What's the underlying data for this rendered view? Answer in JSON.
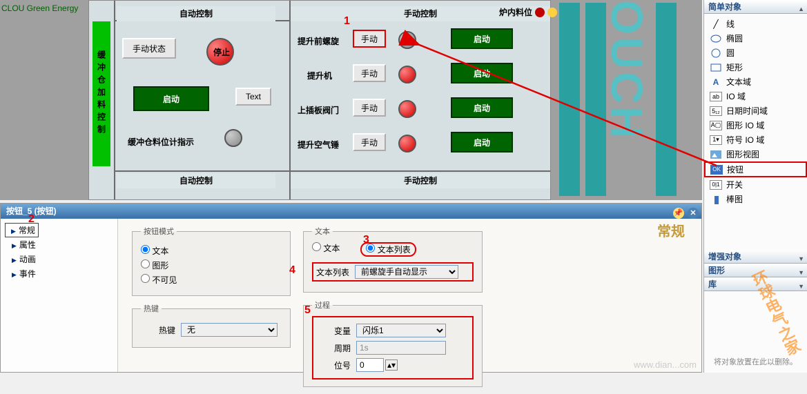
{
  "logo": {
    "brand": "CLOU Green Energy"
  },
  "hmi": {
    "side_label": "缓冲仓加料控制",
    "head_auto": "自动控制",
    "head_manual": "手动控制",
    "head_auto2": "自动控制",
    "head_manual2": "手动控制",
    "manual_status_btn": "手动状态",
    "stop_btn": "停止",
    "start_btn": "启动",
    "text_btn": "Text",
    "level_label": "缓冲仓料位计指示",
    "rows": [
      {
        "label": "提升前螺旋",
        "btn": "手动",
        "start": "启动"
      },
      {
        "label": "提升机",
        "btn": "手动",
        "start": "启动"
      },
      {
        "label": "上插板阀门",
        "btn": "手动",
        "start": "启动"
      },
      {
        "label": "提升空气锤",
        "btn": "手动",
        "start": "启动"
      }
    ],
    "furnace_label": "炉内料位",
    "ouch": "OUCH"
  },
  "toolbox": {
    "head_simple": "简单对象",
    "items": [
      {
        "name": "线"
      },
      {
        "name": "椭圆"
      },
      {
        "name": "圆"
      },
      {
        "name": "矩形"
      },
      {
        "name": "文本域"
      },
      {
        "name": "IO 域"
      },
      {
        "name": "日期时间域"
      },
      {
        "name": "图形 IO 域"
      },
      {
        "name": "符号 IO 域"
      },
      {
        "name": "图形视图"
      },
      {
        "name": "按钮"
      },
      {
        "name": "开关"
      },
      {
        "name": "棒图"
      }
    ],
    "head_enh": "增强对象",
    "head_gfx": "图形",
    "head_lib": "库",
    "drop_hint": "将对象放置在此以删除。"
  },
  "prop": {
    "title": "按钮_5 (按钮)",
    "tree": {
      "general": "常规",
      "props": "属性",
      "anim": "动画",
      "events": "事件"
    },
    "heading": "常规",
    "mode_grp": "按钮模式",
    "mode_text": "文本",
    "mode_gfx": "图形",
    "mode_invis": "不可见",
    "hotkey_grp": "热键",
    "hotkey_lbl": "热键",
    "hotkey_val": "无",
    "text_grp": "文本",
    "text_opt": "文本",
    "textlist_opt": "文本列表",
    "textlist_lbl": "文本列表",
    "textlist_val": "前螺旋手自动显示",
    "proc_grp": "过程",
    "var_lbl": "变量",
    "var_val": "闪烁1",
    "cycle_lbl": "周期",
    "cycle_val": "1s",
    "bit_lbl": "位号",
    "bit_val": "0"
  },
  "annot": {
    "n1": "1",
    "n2": "2",
    "n3": "3",
    "n4": "4",
    "n5": "5"
  },
  "watermark": "环球电气之家",
  "wm2": "www.dian...com"
}
